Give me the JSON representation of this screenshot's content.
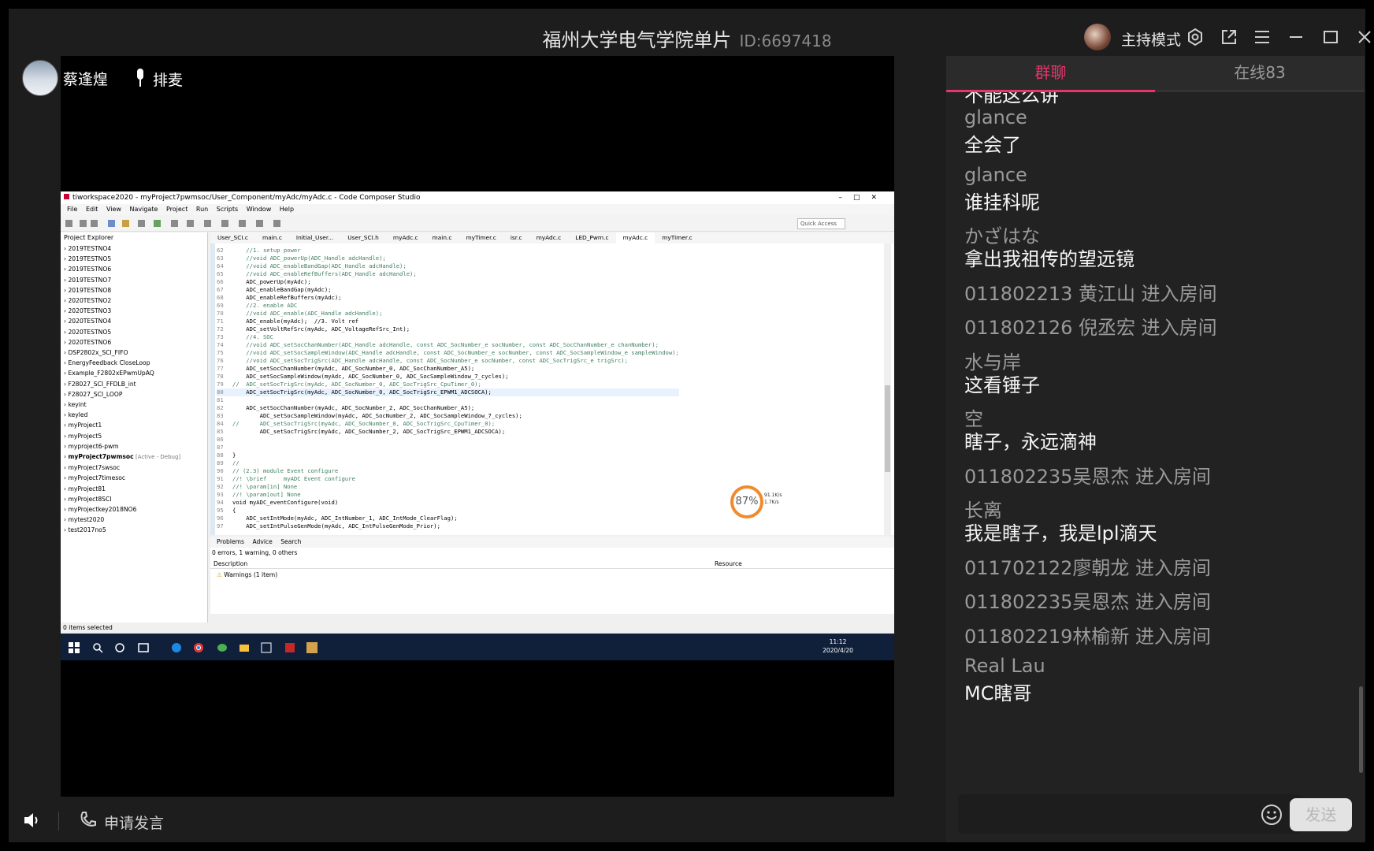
{
  "header": {
    "room_title": "福州大学电气学院单片",
    "room_id": "ID:6697418",
    "host_mode_label": "主持模式"
  },
  "stage": {
    "speaker_name": "蔡逢煌",
    "queue_label": "排麦"
  },
  "shared_screen": {
    "window_title": "tiworkspace2020 - myProject7pwmsoc/User_Component/myAdc/myAdc.c - Code Composer Studio",
    "menu": [
      "File",
      "Edit",
      "View",
      "Navigate",
      "Project",
      "Run",
      "Scripts",
      "Window",
      "Help"
    ],
    "quick_access": "Quick Access",
    "explorer_title": "Project Explorer",
    "projects": [
      "2019TESTNO4",
      "2019TESTNO5",
      "2019TESTNO6",
      "2019TESTNO7",
      "2019TESTNO8",
      "2020TESTNO2",
      "2020TESTNO3",
      "2020TESTNO4",
      "2020TESTNO5",
      "2020TESTNO6",
      "DSP2802x_SCI_FIFO",
      "EnergyFeedback CloseLoop",
      "Example_F2802xEPwmUpAQ",
      "F28027_SCI_FFDLB_int",
      "F28027_SCI_LOOP",
      "keyint",
      "keyled",
      "myProject1",
      "myProject5",
      "myproject6-pwm",
      "myProject7pwmsoc",
      "myProject7swsoc",
      "myProject7timesoc",
      "myProject81",
      "myProject8SCI",
      "myProjectkey2018NO6",
      "mytest2020",
      "test2017no5"
    ],
    "active_project_tag": "[Active - Debug]",
    "editor_tabs": [
      "User_SCI.c",
      "main.c",
      "Initial_User...",
      "User_SCI.h",
      "myAdc.c",
      "main.c",
      "myTimer.c",
      "isr.c",
      "myAdc.c",
      "LED_Pwm.c",
      "myAdc.c",
      "myTimer.c"
    ],
    "code_lines": [
      {
        "n": "62",
        "t": "    //1. setup power",
        "c": true
      },
      {
        "n": "63",
        "t": "    //void ADC_powerUp(ADC_Handle adcHandle);",
        "c": true
      },
      {
        "n": "64",
        "t": "    //void ADC_enableBandGap(ADC_Handle adcHandle);",
        "c": true
      },
      {
        "n": "65",
        "t": "    //void ADC_enableRefBuffers(ADC_Handle adcHandle);",
        "c": true
      },
      {
        "n": "66",
        "t": "    ADC_powerUp(myAdc);",
        "c": false
      },
      {
        "n": "67",
        "t": "    ADC_enableBandGap(myAdc);",
        "c": false
      },
      {
        "n": "68",
        "t": "    ADC_enableRefBuffers(myAdc);",
        "c": false
      },
      {
        "n": "69",
        "t": "    //2. enable ADC",
        "c": true
      },
      {
        "n": "70",
        "t": "    //void ADC_enable(ADC_Handle adcHandle);",
        "c": true
      },
      {
        "n": "71",
        "t": "    ADC_enable(myAdc);  //3. Volt ref",
        "c": false
      },
      {
        "n": "72",
        "t": "    ADC_setVoltRefSrc(myAdc, ADC_VoltageRefSrc_Int);",
        "c": false
      },
      {
        "n": "73",
        "t": "    //4. SOC",
        "c": true
      },
      {
        "n": "74",
        "t": "    //void ADC_setSocChanNumber(ADC_Handle adcHandle, const ADC_SocNumber_e socNumber, const ADC_SocChanNumber_e chanNumber);",
        "c": true
      },
      {
        "n": "75",
        "t": "    //void ADC_setSocSampleWindow(ADC_Handle adcHandle, const ADC_SocNumber_e socNumber, const ADC_SocSampleWindow_e sampleWindow);",
        "c": true
      },
      {
        "n": "76",
        "t": "    //void ADC_setSocTrigSrc(ADC_Handle adcHandle, const ADC_SocNumber_e socNumber, const ADC_SocTrigSrc_e trigSrc);",
        "c": true
      },
      {
        "n": "77",
        "t": "    ADC_setSocChanNumber(myAdc, ADC_SocNumber_0, ADC_SocChanNumber_A5);",
        "c": false
      },
      {
        "n": "78",
        "t": "    ADC_setSocSampleWindow(myAdc, ADC_SocNumber_0, ADC_SocSampleWindow_7_cycles);",
        "c": false
      },
      {
        "n": "79",
        "t": "//  ADC_setSocTrigSrc(myAdc, ADC_SocNumber_0, ADC_SocTrigSrc_CpuTimer_0);",
        "c": true
      },
      {
        "n": "80",
        "t": "    ADC_setSocTrigSrc(myAdc, ADC_SocNumber_0, ADC_SocTrigSrc_EPWM1_ADCSOCA);",
        "c": false
      },
      {
        "n": "81",
        "t": "",
        "c": false
      },
      {
        "n": "82",
        "t": "    ADC_setSocChanNumber(myAdc, ADC_SocNumber_2, ADC_SocChanNumber_A5);",
        "c": false
      },
      {
        "n": "83",
        "t": "        ADC_setSocSampleWindow(myAdc, ADC_SocNumber_2, ADC_SocSampleWindow_7_cycles);",
        "c": false
      },
      {
        "n": "84",
        "t": "//      ADC_setSocTrigSrc(myAdc, ADC_SocNumber_0, ADC_SocTrigSrc_CpuTimer_0);",
        "c": true
      },
      {
        "n": "85",
        "t": "        ADC_setSocTrigSrc(myAdc, ADC_SocNumber_2, ADC_SocTrigSrc_EPWM1_ADCSOCA);",
        "c": false
      },
      {
        "n": "86",
        "t": "",
        "c": false
      },
      {
        "n": "87",
        "t": "",
        "c": false
      },
      {
        "n": "88",
        "t": "}",
        "c": false
      },
      {
        "n": "89",
        "t": "//",
        "c": true
      },
      {
        "n": "90",
        "t": "// (2.3) module Event configure",
        "c": true
      },
      {
        "n": "91",
        "t": "//! \\brief     myADC Event configure",
        "c": true
      },
      {
        "n": "92",
        "t": "//! \\param[in] None",
        "c": true
      },
      {
        "n": "93",
        "t": "//! \\param[out] None",
        "c": true
      },
      {
        "n": "94",
        "t": "void myADC_eventConfigure(void)",
        "c": false
      },
      {
        "n": "95",
        "t": "{",
        "c": false
      },
      {
        "n": "96",
        "t": "    ADC_setIntMode(myAdc, ADC_IntNumber_1, ADC_IntMode_ClearFlag);",
        "c": false
      },
      {
        "n": "97",
        "t": "    ADC_setIntPulseGenMode(myAdc, ADC_IntPulseGenMode_Prior);",
        "c": false
      }
    ],
    "perf_percent": "87%",
    "net_up": "91.1K/s",
    "net_down": "1.7K/s",
    "problems_tab": "Problems",
    "advice_tab": "Advice",
    "search_tab": "Search",
    "problems_summary": "0 errors, 1 warning, 0 others",
    "col_description": "Description",
    "col_resource": "Resource",
    "warnings_row": "Warnings (1 item)",
    "status": "0 items selected",
    "clock_time": "11:12",
    "clock_date": "2020/4/20"
  },
  "controls": {
    "request_speak_label": "申请发言"
  },
  "chat": {
    "tab_group": "群聊",
    "tab_online": "在线83",
    "partial_top": "不能这么讲",
    "messages": [
      {
        "user": "glance",
        "text": "全会了"
      },
      {
        "user": "glance",
        "text": "谁挂科呢"
      },
      {
        "user": "かざはな",
        "text": "拿出我祖传的望远镜"
      },
      {
        "system": "011802213 黄江山 进入房间"
      },
      {
        "system": "011802126 倪丞宏 进入房间"
      },
      {
        "user": "水与岸",
        "text": "这看锤子"
      },
      {
        "user": "空",
        "text": "瞎子，永远滴神"
      },
      {
        "system": "011802235吴恩杰 进入房间"
      },
      {
        "user": "长离",
        "text": "我是瞎子，我是lpl滴天"
      },
      {
        "system": "011702122廖朝龙 进入房间"
      },
      {
        "system": "011802235吴恩杰 进入房间"
      },
      {
        "system": "011802219林榆新 进入房间"
      },
      {
        "user": "Real Lau",
        "text": "MC瞎哥"
      }
    ],
    "send_label": "发送"
  },
  "colors": {
    "accent": "#e5366b",
    "panel": "#222222",
    "frame": "#1d1d1d"
  }
}
